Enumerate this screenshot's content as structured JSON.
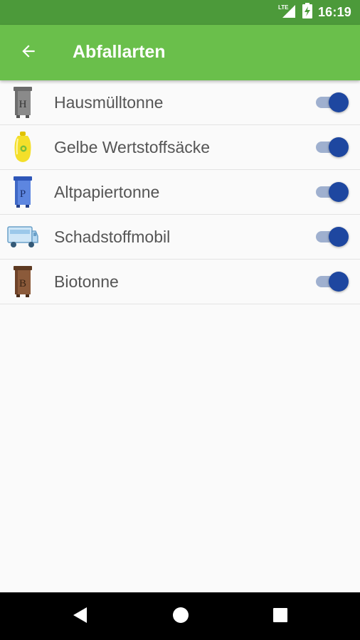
{
  "status_bar": {
    "network": "LTE",
    "time": "16:19",
    "icons": [
      "lte-signal-icon",
      "battery-charging-icon"
    ]
  },
  "app_bar": {
    "back_icon": "arrow-back-icon",
    "title": "Abfallarten"
  },
  "waste_types": [
    {
      "label": "Hausmülltonne",
      "icon": "grey-bin-icon",
      "icon_letter": "H",
      "enabled": true
    },
    {
      "label": "Gelbe Wertstoffsäcke",
      "icon": "yellow-bag-icon",
      "enabled": true
    },
    {
      "label": "Altpapiertonne",
      "icon": "blue-bin-icon",
      "icon_letter": "P",
      "enabled": true
    },
    {
      "label": "Schadstoffmobil",
      "icon": "truck-icon",
      "enabled": true
    },
    {
      "label": "Biotonne",
      "icon": "brown-bin-icon",
      "icon_letter": "B",
      "enabled": true
    }
  ],
  "nav_bar": {
    "buttons": [
      "back-triangle-icon",
      "home-circle-icon",
      "recents-square-icon"
    ]
  },
  "colors": {
    "status_bar": "#4c9a3a",
    "app_bar": "#6abf4b",
    "switch_thumb": "#1e47a0",
    "switch_track": "#9fb0cf"
  }
}
